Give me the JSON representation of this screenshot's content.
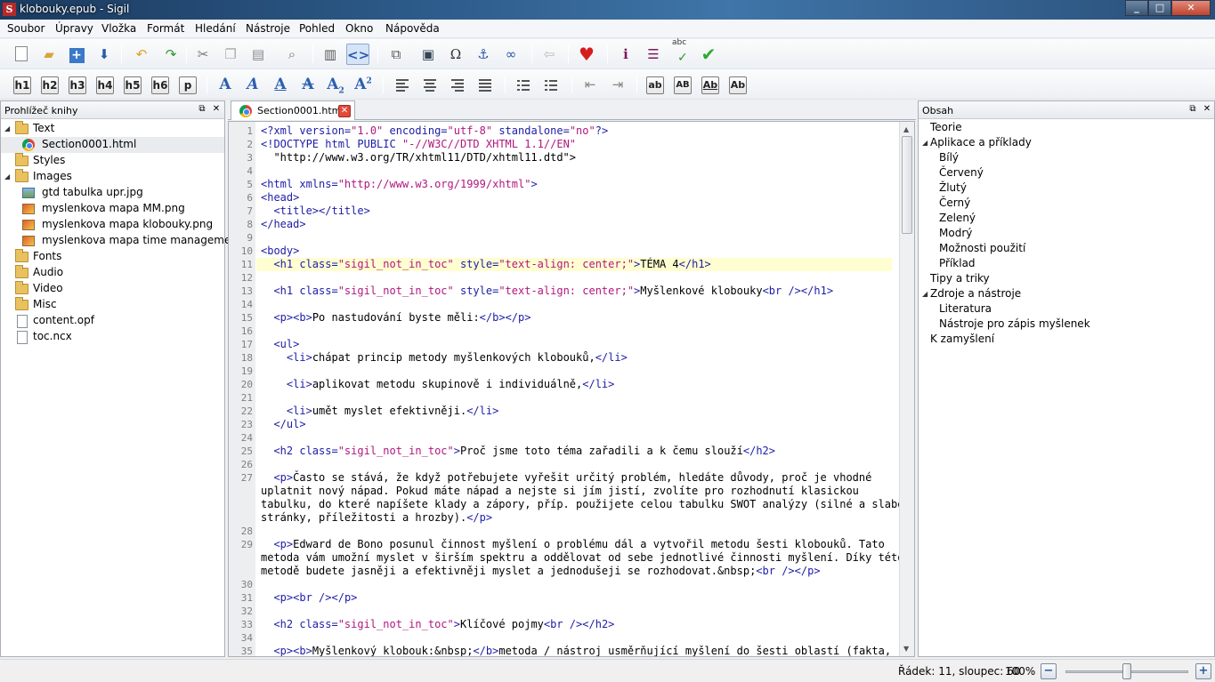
{
  "window": {
    "title": "klobouky.epub - Sigil"
  },
  "menu": [
    "Soubor",
    "Úpravy",
    "Vložka",
    "Formát",
    "Hledání",
    "Nástroje",
    "Pohled",
    "Okno",
    "Nápověda"
  ],
  "heading_buttons": [
    "h1",
    "h2",
    "h3",
    "h4",
    "h5",
    "h6",
    "p"
  ],
  "case_buttons": [
    "ab",
    "AB",
    "Ab",
    "Ab"
  ],
  "spellcheck_label": "abc",
  "book_browser": {
    "title": "Prohlížeč knihy",
    "items": [
      {
        "label": "Text",
        "type": "folder",
        "level": 0,
        "expanded": true
      },
      {
        "label": "Section0001.html",
        "type": "html",
        "level": 1,
        "selected": true
      },
      {
        "label": "Styles",
        "type": "folder",
        "level": 0
      },
      {
        "label": "Images",
        "type": "folder",
        "level": 0,
        "expanded": true
      },
      {
        "label": "gtd tabulka upr.jpg",
        "type": "image-jpg",
        "level": 1
      },
      {
        "label": "myslenkova mapa MM.png",
        "type": "image-png",
        "level": 1
      },
      {
        "label": "myslenkova mapa klobouky.png",
        "type": "image-png",
        "level": 1
      },
      {
        "label": "myslenkova mapa time manageme...",
        "type": "image-png",
        "level": 1
      },
      {
        "label": "Fonts",
        "type": "folder",
        "level": 0
      },
      {
        "label": "Audio",
        "type": "folder",
        "level": 0
      },
      {
        "label": "Video",
        "type": "folder",
        "level": 0
      },
      {
        "label": "Misc",
        "type": "folder",
        "level": 0
      },
      {
        "label": "content.opf",
        "type": "file",
        "level": 0
      },
      {
        "label": "toc.ncx",
        "type": "file",
        "level": 0
      }
    ]
  },
  "editor": {
    "tab_label": "Section0001.html",
    "current_line": 11,
    "lines": [
      {
        "n": "1",
        "text": "<?xml version=\"1.0\" encoding=\"utf-8\" standalone=\"no\"?>"
      },
      {
        "n": "2",
        "text": "<!DOCTYPE html PUBLIC \"-//W3C//DTD XHTML 1.1//EN\""
      },
      {
        "n": "3",
        "text": "  \"http://www.w3.org/TR/xhtml11/DTD/xhtml11.dtd\">"
      },
      {
        "n": "4",
        "text": ""
      },
      {
        "n": "5",
        "text": "<html xmlns=\"http://www.w3.org/1999/xhtml\">"
      },
      {
        "n": "6",
        "text": "<head>"
      },
      {
        "n": "7",
        "text": "  <title></title>"
      },
      {
        "n": "8",
        "text": "</head>"
      },
      {
        "n": "9",
        "text": ""
      },
      {
        "n": "10",
        "text": "<body>"
      },
      {
        "n": "11",
        "text": "  <h1 class=\"sigil_not_in_toc\" style=\"text-align: center;\">TÉMA 4</h1>"
      },
      {
        "n": "12",
        "text": ""
      },
      {
        "n": "13",
        "text": "  <h1 class=\"sigil_not_in_toc\" style=\"text-align: center;\">Myšlenkové klobouky<br /></h1>"
      },
      {
        "n": "14",
        "text": ""
      },
      {
        "n": "15",
        "text": "  <p><b>Po nastudování byste měli:</b></p>"
      },
      {
        "n": "16",
        "text": ""
      },
      {
        "n": "17",
        "text": "  <ul>"
      },
      {
        "n": "18",
        "text": "    <li>chápat princip metody myšlenkových klobouků,</li>"
      },
      {
        "n": "19",
        "text": ""
      },
      {
        "n": "20",
        "text": "    <li>aplikovat metodu skupinově i individuálně,</li>"
      },
      {
        "n": "21",
        "text": ""
      },
      {
        "n": "22",
        "text": "    <li>umět myslet efektivněji.</li>"
      },
      {
        "n": "23",
        "text": "  </ul>"
      },
      {
        "n": "24",
        "text": ""
      },
      {
        "n": "25",
        "text": "  <h2 class=\"sigil_not_in_toc\">Proč jsme toto téma zařadili a k čemu slouží</h2>"
      },
      {
        "n": "26",
        "text": ""
      },
      {
        "n": "27",
        "text": "  <p>Často se stává, že když potřebujete vyřešit určitý problém, hledáte důvody, proč je vhodné"
      },
      {
        "n": "",
        "text": "uplatnit nový nápad. Pokud máte nápad a nejste si jím jistí, zvolíte pro rozhodnutí klasickou"
      },
      {
        "n": "",
        "text": "tabulku, do které napíšete klady a zápory, příp. použijete celou tabulku SWOT analýzy (silné a slabé"
      },
      {
        "n": "",
        "text": "stránky, příležitosti a hrozby).</p>"
      },
      {
        "n": "28",
        "text": ""
      },
      {
        "n": "29",
        "text": "  <p>Edward de Bono posunul činnost myšlení o problému dál a vytvořil metodu šesti klobouků. Tato"
      },
      {
        "n": "",
        "text": "metoda vám umožní myslet v širším spektru a oddělovat od sebe jednotlivé činnosti myšlení. Díky této"
      },
      {
        "n": "",
        "text": "metodě budete jasněji a efektivněji myslet a jednodušeji se rozhodovat.&nbsp;<br /></p>"
      },
      {
        "n": "30",
        "text": ""
      },
      {
        "n": "31",
        "text": "  <p><br /></p>"
      },
      {
        "n": "32",
        "text": ""
      },
      {
        "n": "33",
        "text": "  <h2 class=\"sigil_not_in_toc\">Klíčové pojmy<br /></h2>"
      },
      {
        "n": "34",
        "text": ""
      },
      {
        "n": "35",
        "text": "  <p><b>Myšlenkový klobouk:&nbsp;</b>metoda / nástroj usměrňující myšlení do šesti oblastí (fakta,"
      }
    ]
  },
  "toc": {
    "title": "Obsah",
    "items": [
      {
        "label": "Teorie",
        "level": 0
      },
      {
        "label": "Aplikace a příklady",
        "level": 0,
        "expanded": true
      },
      {
        "label": "Bílý",
        "level": 1
      },
      {
        "label": "Červený",
        "level": 1
      },
      {
        "label": "Žlutý",
        "level": 1
      },
      {
        "label": "Černý",
        "level": 1
      },
      {
        "label": "Zelený",
        "level": 1
      },
      {
        "label": "Modrý",
        "level": 1
      },
      {
        "label": "Možnosti použití",
        "level": 1
      },
      {
        "label": "Příklad",
        "level": 1
      },
      {
        "label": "Tipy a triky",
        "level": 0
      },
      {
        "label": "Zdroje a nástroje",
        "level": 0,
        "expanded": true
      },
      {
        "label": "Literatura",
        "level": 1
      },
      {
        "label": "Nástroje pro zápis myšlenek",
        "level": 1
      },
      {
        "label": "K zamyšlení",
        "level": 0
      }
    ]
  },
  "status": {
    "position": "Řádek: 11, sloupec: 60",
    "zoom": "100%",
    "zoom_level_percent": 100
  },
  "colors": {
    "tag": "#1c1ca8",
    "attr_value": "#b0177e",
    "current_line": "#fffed1"
  }
}
